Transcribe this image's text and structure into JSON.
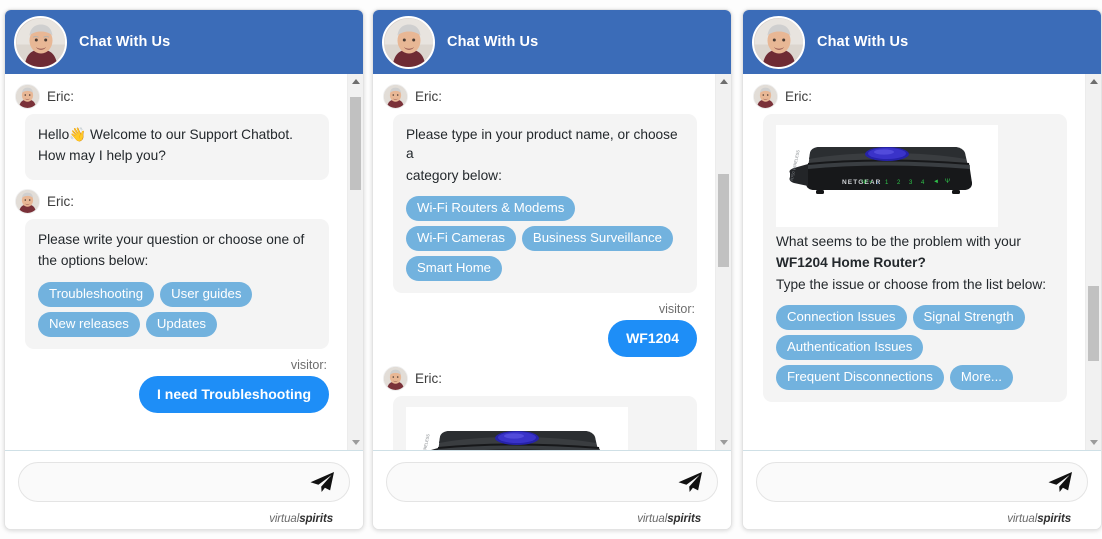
{
  "theme": {
    "header_blue": "#3b6cb8",
    "chip_blue": "#72b2de",
    "visitor_blue": "#1e8ef7",
    "bubble_grey": "#f4f4f4",
    "page_bg": "#ffffff"
  },
  "brand": {
    "part1": "virtual",
    "part2": "spirits"
  },
  "composer": {
    "placeholder": "",
    "value": "",
    "send_icon": "send-paper-plane-icon"
  },
  "panels": [
    {
      "header": {
        "title": "Chat With Us",
        "avatar_icon": "agent-avatar"
      },
      "scroll": {
        "thumb_top_pct": 5,
        "thumb_height_pct": 26
      },
      "messages": [
        {
          "type": "agent",
          "sender": "Eric:",
          "lines": [
            "Hello👋 Welcome to our Support Chatbot.",
            "How may I help you?"
          ],
          "chips": []
        },
        {
          "type": "agent",
          "sender": "Eric:",
          "lines": [
            "Please write your question or choose one of",
            "the options below:"
          ],
          "chips": [
            "Troubleshooting",
            "User guides",
            "New releases",
            "Updates"
          ]
        },
        {
          "type": "visitor",
          "label": "visitor:",
          "text": "I need Troubleshooting"
        }
      ]
    },
    {
      "header": {
        "title": "Chat With Us",
        "avatar_icon": "agent-avatar"
      },
      "scroll": {
        "thumb_top_pct": 22,
        "thumb_height_pct": 26
      },
      "messages": [
        {
          "type": "agent",
          "sender": "Eric:",
          "lines": [
            "Please type in your product name, or choose a",
            "category below:"
          ],
          "chips": [
            "Wi-Fi Routers & Modems",
            "Wi-Fi Cameras",
            "Business Surveillance",
            "Smart Home"
          ]
        },
        {
          "type": "visitor",
          "label": "visitor:",
          "text": "WF1204"
        },
        {
          "type": "agent-image",
          "sender": "Eric:",
          "image": "netgear-router-photo",
          "lines": [],
          "chips": []
        }
      ]
    },
    {
      "header": {
        "title": "Chat With Us",
        "avatar_icon": "agent-avatar"
      },
      "scroll": {
        "thumb_top_pct": 56,
        "thumb_height_pct": 26
      },
      "messages": [
        {
          "type": "agent-image",
          "sender": "Eric:",
          "image": "netgear-router-photo",
          "lines": [
            "What seems to be the problem with your",
            "WF1204 Home Router?",
            "Type the issue or choose from the list below:"
          ],
          "bold_line_index": 1,
          "chips": [
            "Connection Issues",
            "Signal Strength",
            "Authentication Issues",
            "Frequent Disconnections",
            "More..."
          ]
        }
      ]
    }
  ]
}
